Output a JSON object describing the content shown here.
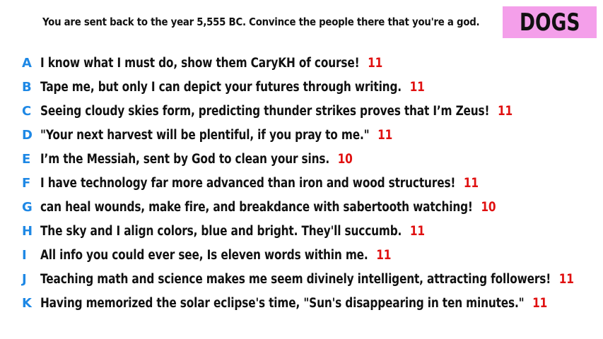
{
  "prompt": "You are sent back to the year 5,555 BC. Convince the people there that you're a god.",
  "badge": {
    "label": "DOGS",
    "color": "#f49fea"
  },
  "colors": {
    "letter": "#1e88e5",
    "count": "#e01010"
  },
  "responses": [
    {
      "letter": "A",
      "text": "I know what I must do, show them CaryKH of course!",
      "count": "11"
    },
    {
      "letter": "B",
      "text": "Tape me, but only I can depict your futures through writing.",
      "count": "11"
    },
    {
      "letter": "C",
      "text": "Seeing cloudy skies form, predicting thunder strikes proves that I’m Zeus!",
      "count": "11"
    },
    {
      "letter": "D",
      "text": "\"Your next harvest will be plentiful, if you pray to me.\"",
      "count": "11"
    },
    {
      "letter": "E",
      "text": "I’m the Messiah, sent by God to clean your sins.",
      "count": "10"
    },
    {
      "letter": "F",
      "text": "I have technology far more advanced than iron and wood structures!",
      "count": "11"
    },
    {
      "letter": "G",
      "text": "can heal wounds, make fire, and breakdance with sabertooth watching!",
      "count": "10"
    },
    {
      "letter": "H",
      "text": "The sky and I align colors, blue and bright. They'll succumb.",
      "count": "11"
    },
    {
      "letter": "I",
      "text": "All info you could ever see, Is eleven words within me.",
      "count": "11"
    },
    {
      "letter": "J",
      "text": "Teaching math and science makes me seem divinely intelligent, attracting followers!",
      "count": "11"
    },
    {
      "letter": "K",
      "text": "Having memorized the solar eclipse's time, \"Sun's disappearing in ten minutes.\"",
      "count": "11"
    }
  ]
}
